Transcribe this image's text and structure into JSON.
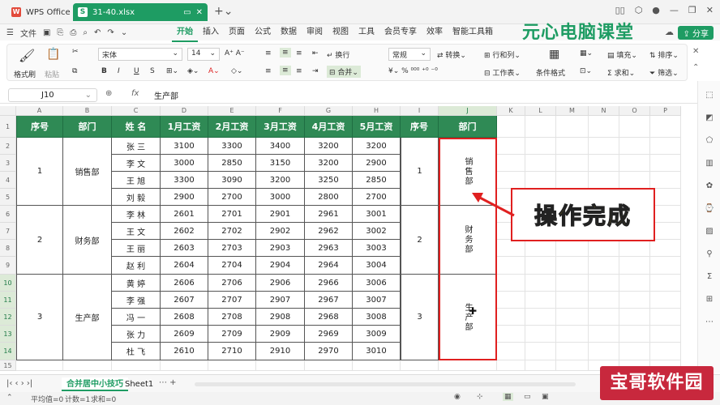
{
  "titlebar": {
    "home_tab": "WPS Office",
    "file_tab": "31-40.xlsx"
  },
  "menubar": {
    "file_label": "文件",
    "tabs": [
      "开始",
      "插入",
      "页面",
      "公式",
      "数据",
      "审阅",
      "视图",
      "工具",
      "会员专享",
      "效率",
      "智能工具箱"
    ],
    "active_tab": "开始",
    "share_label": "分享"
  },
  "brand_text": "元心电脑课堂",
  "ribbon": {
    "format_painter": "格式刷",
    "paste": "粘贴",
    "font_name": "宋体",
    "font_size": "14",
    "wrap": "换行",
    "merge": "合并",
    "number_format": "常规",
    "convert": "转换",
    "row_col": "行和列",
    "worksheet": "工作表",
    "conditional": "条件格式",
    "fill": "填充",
    "sort": "排序",
    "sum": "求和",
    "filter": "筛选"
  },
  "formula_bar": {
    "name_box": "J10",
    "fx": "fx",
    "content": "生产部"
  },
  "columns": [
    "A",
    "B",
    "C",
    "D",
    "E",
    "F",
    "G",
    "H",
    "I",
    "J",
    "K",
    "L",
    "M",
    "N",
    "O",
    "P"
  ],
  "rows": [
    "1",
    "2",
    "3",
    "4",
    "5",
    "6",
    "7",
    "8",
    "9",
    "10",
    "11",
    "12",
    "13",
    "14",
    "15"
  ],
  "table": {
    "headers": [
      "序号",
      "部门",
      "姓  名",
      "1月工资",
      "2月工资",
      "3月工资",
      "4月工资",
      "5月工资",
      "序号",
      "部门"
    ],
    "groups": [
      {
        "no": "1",
        "dept": "销售部",
        "dept_vertical": "销售部"
      },
      {
        "no": "2",
        "dept": "财务部",
        "dept_vertical": "财务部"
      },
      {
        "no": "3",
        "dept": "生产部",
        "dept_vertical": "生产部"
      }
    ],
    "rows": [
      [
        "张  三",
        "3100",
        "3300",
        "3400",
        "3200",
        "3200"
      ],
      [
        "李  文",
        "3000",
        "2850",
        "3150",
        "3200",
        "2900"
      ],
      [
        "王  旭",
        "3300",
        "3090",
        "3200",
        "3250",
        "2850"
      ],
      [
        "刘  毅",
        "2900",
        "2700",
        "3000",
        "2800",
        "2700"
      ],
      [
        "李  林",
        "2601",
        "2701",
        "2901",
        "2961",
        "3001"
      ],
      [
        "王  文",
        "2602",
        "2702",
        "2902",
        "2962",
        "3002"
      ],
      [
        "王  丽",
        "2603",
        "2703",
        "2903",
        "2963",
        "3003"
      ],
      [
        "赵  利",
        "2604",
        "2704",
        "2904",
        "2964",
        "3004"
      ],
      [
        "黄  婷",
        "2606",
        "2706",
        "2906",
        "2966",
        "3006"
      ],
      [
        "李  强",
        "2607",
        "2707",
        "2907",
        "2967",
        "3007"
      ],
      [
        "冯  一",
        "2608",
        "2708",
        "2908",
        "2968",
        "3008"
      ],
      [
        "张  力",
        "2609",
        "2709",
        "2909",
        "2969",
        "3009"
      ],
      [
        "杜  飞",
        "2610",
        "2710",
        "2910",
        "2970",
        "3010"
      ]
    ]
  },
  "callout": "操作完成",
  "sheets": {
    "tabs": [
      "合并居中小技巧",
      "Sheet1"
    ],
    "active": "合并居中小技巧"
  },
  "status": {
    "average": "平均值=0",
    "count": "计数=1",
    "sum": "求和=0"
  },
  "watermark": "宝哥软件园",
  "colors": {
    "accent": "#1e9c63",
    "header_fill": "#2f8a55",
    "highlight": "#e02020",
    "callout_text": "#f5d300"
  }
}
